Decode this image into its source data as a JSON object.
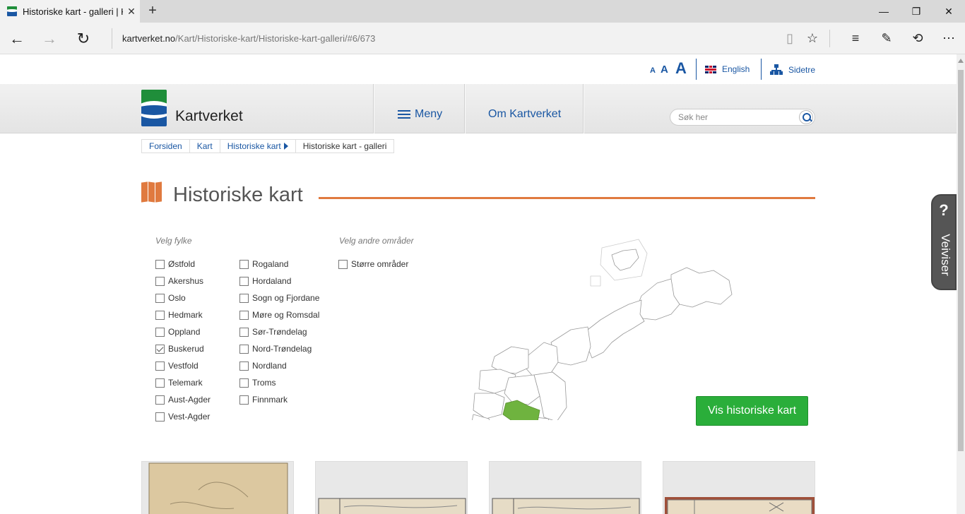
{
  "browser": {
    "tab_title": "Historiske kart - galleri | K",
    "url_domain": "kartverket.no",
    "url_path": "/Kart/Historiske-kart/Historiske-kart-galleri/#6/673"
  },
  "utility": {
    "font_small": "A",
    "font_medium": "A",
    "font_large": "A",
    "english_label": "English",
    "sitemap_label": "Sidetre"
  },
  "header": {
    "brand": "Kartverket",
    "menu_label": "Meny",
    "about_label": "Om Kartverket",
    "search_placeholder": "Søk her"
  },
  "breadcrumb": [
    "Forsiden",
    "Kart",
    "Historiske kart",
    "Historiske kart - galleri"
  ],
  "page": {
    "title": "Historiske kart",
    "col1_heading": "Velg fylke",
    "col2_heading": "Velg andre områder"
  },
  "fylker_col1": [
    {
      "label": "Østfold",
      "checked": false
    },
    {
      "label": "Akershus",
      "checked": false
    },
    {
      "label": "Oslo",
      "checked": false
    },
    {
      "label": "Hedmark",
      "checked": false
    },
    {
      "label": "Oppland",
      "checked": false
    },
    {
      "label": "Buskerud",
      "checked": true
    },
    {
      "label": "Vestfold",
      "checked": false
    },
    {
      "label": "Telemark",
      "checked": false
    },
    {
      "label": "Aust-Agder",
      "checked": false
    },
    {
      "label": "Vest-Agder",
      "checked": false
    }
  ],
  "fylker_col2": [
    {
      "label": "Rogaland",
      "checked": false
    },
    {
      "label": "Hordaland",
      "checked": false
    },
    {
      "label": "Sogn og Fjordane",
      "checked": false
    },
    {
      "label": "Møre og Romsdal",
      "checked": false
    },
    {
      "label": "Sør-Trøndelag",
      "checked": false
    },
    {
      "label": "Nord-Trøndelag",
      "checked": false
    },
    {
      "label": "Nordland",
      "checked": false
    },
    {
      "label": "Troms",
      "checked": false
    },
    {
      "label": "Finnmark",
      "checked": false
    }
  ],
  "other_areas": [
    {
      "label": "Større områder",
      "checked": false
    }
  ],
  "map": {
    "highlight_color": "#6fb33f",
    "outline_color": "#999999"
  },
  "show_button": "Vis historiske kart",
  "veiviser": {
    "icon": "?",
    "label": "Veiviser"
  }
}
